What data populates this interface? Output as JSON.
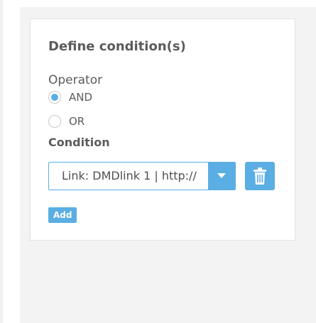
{
  "panel": {
    "title": "Define condition(s)"
  },
  "operator": {
    "label": "Operator",
    "options": [
      {
        "label": "AND",
        "selected": true
      },
      {
        "label": "OR",
        "selected": false
      }
    ]
  },
  "condition": {
    "label": "Condition",
    "selected_value": "Link: DMDlink 1 | http://",
    "dropdown_icon": "chevron-down-icon",
    "delete_icon": "trash-icon"
  },
  "actions": {
    "add_label": "Add"
  },
  "colors": {
    "accent": "#5aaee3",
    "text": "#5c5c5c",
    "panel_background": "#ffffff",
    "page_background": "#f3f3f3"
  }
}
